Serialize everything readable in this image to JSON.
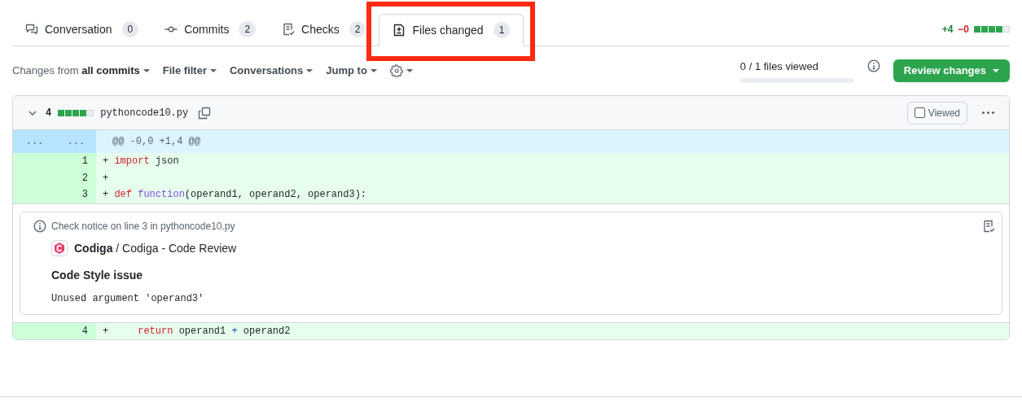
{
  "tabs": [
    {
      "label": "Conversation",
      "count": "0",
      "selected": false,
      "highlighted": false
    },
    {
      "label": "Commits",
      "count": "2",
      "selected": false,
      "highlighted": false
    },
    {
      "label": "Checks",
      "count": "2",
      "selected": false,
      "highlighted": false
    },
    {
      "label": "Files changed",
      "count": "1",
      "selected": true,
      "highlighted": true
    }
  ],
  "summary": {
    "additions": "+4",
    "deletions": "−0",
    "blocks": [
      {
        "kind": "added"
      },
      {
        "kind": "added"
      },
      {
        "kind": "added"
      },
      {
        "kind": "added"
      },
      {
        "kind": "neutral"
      }
    ]
  },
  "toolbar": {
    "changes_prefix": "Changes from",
    "changes_value": "all commits",
    "menus": [
      "File filter",
      "Conversations",
      "Jump to"
    ],
    "files_viewed": "0 / 1 files viewed",
    "level": 0,
    "review_button": "Review changes"
  },
  "file": {
    "expanded": true,
    "change_count": "4",
    "blocks": [
      {
        "kind": "added"
      },
      {
        "kind": "added"
      },
      {
        "kind": "added"
      },
      {
        "kind": "added"
      },
      {
        "kind": "neutral"
      }
    ],
    "name": "pythoncode10.py",
    "viewed_label": "Viewed",
    "viewed": false,
    "rows": [
      {
        "kind": "hunk",
        "old": "...",
        "new": "...",
        "tokens": [
          {
            "text": "@@ -0,0 +1,4 @@"
          }
        ]
      },
      {
        "kind": "added",
        "new": "1",
        "tokens": [
          {
            "text": "+ ",
            "kind": "plain"
          },
          {
            "text": "import",
            "kind": "keyword"
          },
          {
            "text": " json",
            "kind": "plain"
          }
        ]
      },
      {
        "kind": "added",
        "new": "2",
        "tokens": [
          {
            "text": "+",
            "kind": "plain"
          }
        ]
      },
      {
        "kind": "added",
        "new": "3",
        "tokens": [
          {
            "text": "+ ",
            "kind": "plain"
          },
          {
            "text": "def",
            "kind": "keyword"
          },
          {
            "text": " function",
            "kind": "function"
          },
          {
            "text": "(operand1, operand2, operand3):",
            "kind": "plain"
          }
        ]
      },
      {
        "kind": "annotation",
        "title": "Check notice on line 3 in pythoncode10.py",
        "app": "Codiga",
        "check": " / Codiga - Code Review",
        "heading": "Code Style issue",
        "message": "Unused argument 'operand3'"
      },
      {
        "kind": "added",
        "new": "4",
        "tokens": [
          {
            "text": "+     ",
            "kind": "plain"
          },
          {
            "text": "return",
            "kind": "keyword"
          },
          {
            "text": " operand1 ",
            "kind": "plain"
          },
          {
            "text": "+",
            "kind": "operator"
          },
          {
            "text": " operand2",
            "kind": "plain"
          }
        ]
      }
    ]
  }
}
